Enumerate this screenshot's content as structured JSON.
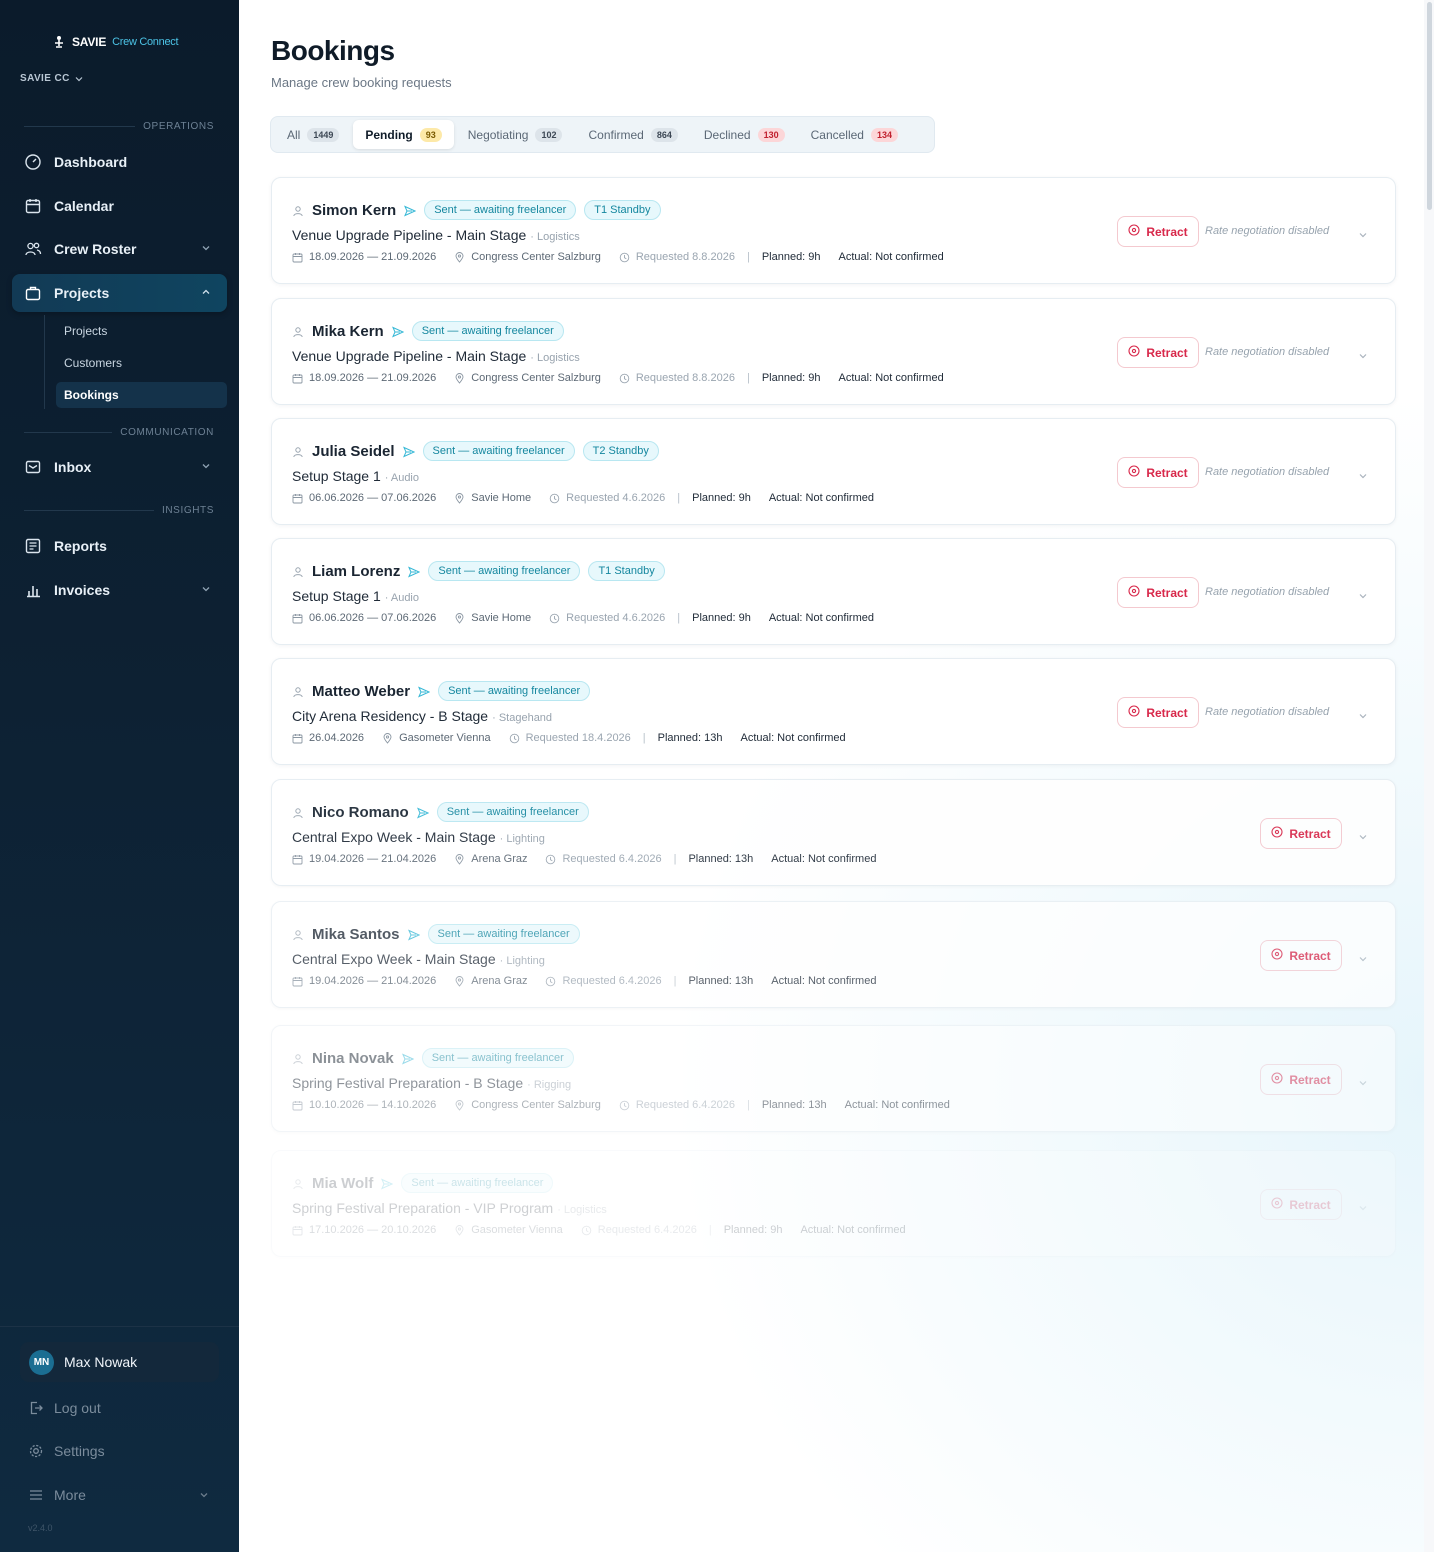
{
  "brand": {
    "name": "SAVIE",
    "product": "Crew Connect"
  },
  "org": {
    "label": "SAVIE CC"
  },
  "sidebar": {
    "sections": {
      "operations": "OPERATIONS",
      "communication": "COMMUNICATION",
      "insights": "INSIGHTS"
    },
    "items": {
      "dashboard": "Dashboard",
      "calendar": "Calendar",
      "crew_roster": "Crew Roster",
      "projects": "Projects",
      "inbox": "Inbox",
      "reports": "Reports",
      "invoices": "Invoices"
    },
    "sub_items": {
      "projects": "Projects",
      "customers": "Customers",
      "bookings": "Bookings"
    },
    "user": {
      "initials": "MN",
      "name": "Max Nowak"
    },
    "footer": {
      "logout": "Log out",
      "settings": "Settings",
      "more": "More"
    },
    "version": "v2.4.0"
  },
  "page": {
    "title": "Bookings",
    "subtitle": "Manage crew booking requests"
  },
  "tabs": [
    {
      "label": "All",
      "count": "1449",
      "style": "grey"
    },
    {
      "label": "Pending",
      "count": "93",
      "style": "yellow",
      "active": true
    },
    {
      "label": "Negotiating",
      "count": "102",
      "style": "grey"
    },
    {
      "label": "Confirmed",
      "count": "864",
      "style": "grey"
    },
    {
      "label": "Declined",
      "count": "130",
      "style": "red"
    },
    {
      "label": "Cancelled",
      "count": "134",
      "style": "red"
    }
  ],
  "actions": {
    "retract": "Retract",
    "rate_note": "Rate negotiation disabled"
  },
  "bookings": [
    {
      "name": "Simon Kern",
      "status": "Sent — awaiting freelancer",
      "standby": "T1 Standby",
      "project": "Venue Upgrade Pipeline - Main Stage",
      "dept": "· Logistics",
      "dates": "18.09.2026 — 21.09.2026",
      "location": "Congress Center Salzburg",
      "requested": "Requested 8.8.2026",
      "planned": "Planned: 9h",
      "actual": "Actual: Not confirmed",
      "rate_disabled": true
    },
    {
      "name": "Mika Kern",
      "status": "Sent — awaiting freelancer",
      "standby": "",
      "project": "Venue Upgrade Pipeline - Main Stage",
      "dept": "· Logistics",
      "dates": "18.09.2026 — 21.09.2026",
      "location": "Congress Center Salzburg",
      "requested": "Requested 8.8.2026",
      "planned": "Planned: 9h",
      "actual": "Actual: Not confirmed",
      "rate_disabled": true
    },
    {
      "name": "Julia Seidel",
      "status": "Sent — awaiting freelancer",
      "standby": "T2 Standby",
      "project": "Setup Stage 1",
      "dept": "· Audio",
      "dates": "06.06.2026 — 07.06.2026",
      "location": "Savie Home",
      "requested": "Requested 4.6.2026",
      "planned": "Planned: 9h",
      "actual": "Actual: Not confirmed",
      "rate_disabled": true
    },
    {
      "name": "Liam Lorenz",
      "status": "Sent — awaiting freelancer",
      "standby": "T1 Standby",
      "project": "Setup Stage 1",
      "dept": "· Audio",
      "dates": "06.06.2026 — 07.06.2026",
      "location": "Savie Home",
      "requested": "Requested 4.6.2026",
      "planned": "Planned: 9h",
      "actual": "Actual: Not confirmed",
      "rate_disabled": true
    },
    {
      "name": "Matteo Weber",
      "status": "Sent — awaiting freelancer",
      "standby": "",
      "project": "City Arena Residency - B Stage",
      "dept": "· Stagehand",
      "dates": "26.04.2026",
      "location": "Gasometer Vienna",
      "requested": "Requested 18.4.2026",
      "planned": "Planned: 13h",
      "actual": "Actual: Not confirmed",
      "rate_disabled": true
    },
    {
      "name": "Nico Romano",
      "status": "Sent — awaiting freelancer",
      "standby": "",
      "project": "Central Expo Week - Main Stage",
      "dept": "· Lighting",
      "dates": "19.04.2026 — 21.04.2026",
      "location": "Arena Graz",
      "requested": "Requested 6.4.2026",
      "planned": "Planned: 13h",
      "actual": "Actual: Not confirmed",
      "rate_disabled": false
    },
    {
      "name": "Mika Santos",
      "status": "Sent — awaiting freelancer",
      "standby": "",
      "project": "Central Expo Week - Main Stage",
      "dept": "· Lighting",
      "dates": "19.04.2026 — 21.04.2026",
      "location": "Arena Graz",
      "requested": "Requested 6.4.2026",
      "planned": "Planned: 13h",
      "actual": "Actual: Not confirmed",
      "rate_disabled": false
    },
    {
      "name": "Nina Novak",
      "status": "Sent — awaiting freelancer",
      "standby": "",
      "project": "Spring Festival Preparation - B Stage",
      "dept": "· Rigging",
      "dates": "10.10.2026 — 14.10.2026",
      "location": "Congress Center Salzburg",
      "requested": "Requested 6.4.2026",
      "planned": "Planned: 13h",
      "actual": "Actual: Not confirmed",
      "rate_disabled": false
    },
    {
      "name": "Mia Wolf",
      "status": "Sent — awaiting freelancer",
      "standby": "",
      "project": "Spring Festival Preparation - VIP Program",
      "dept": "· Logistics",
      "dates": "17.10.2026 — 20.10.2026",
      "location": "Gasometer Vienna",
      "requested": "Requested 6.4.2026",
      "planned": "Planned: 9h",
      "actual": "Actual: Not confirmed",
      "rate_disabled": false
    }
  ],
  "colors": {
    "accent": "#15879f",
    "danger": "#d8284a",
    "sidebar": "#0d2133"
  }
}
